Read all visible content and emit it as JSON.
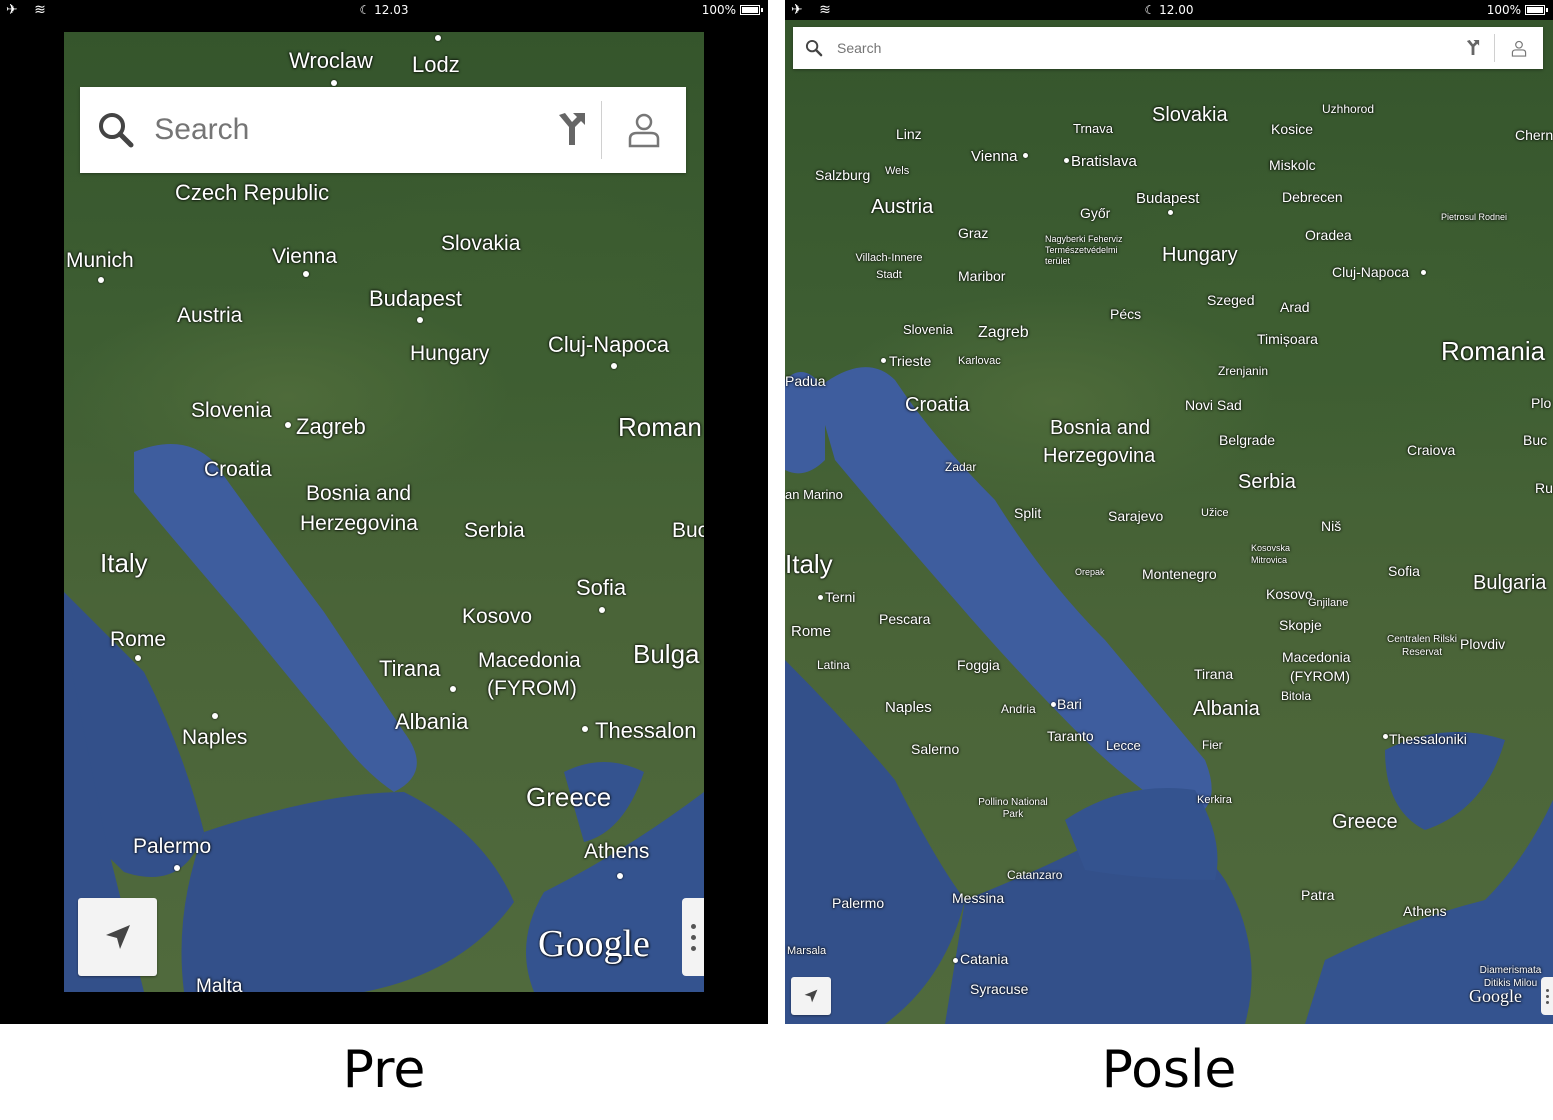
{
  "colors": {
    "sea": "#3d5a9a",
    "land": "#3f5f33",
    "searchbar": "#ffffff",
    "label": "#ffffff"
  },
  "pre": {
    "status": {
      "time": "12.03",
      "battery": "100%",
      "left_icons": "airplane-icon wifi-icon"
    },
    "search": {
      "placeholder": "Search"
    },
    "labels": {
      "wroclaw": "Wroclaw",
      "lodz": "Lodz",
      "czech": "Czech Republic",
      "munich": "Munich",
      "vienna": "Vienna",
      "slovakia": "Slovakia",
      "budapest": "Budapest",
      "austria": "Austria",
      "hungary": "Hungary",
      "cluj": "Cluj-Napoca",
      "slovenia": "Slovenia",
      "zagreb": "Zagreb",
      "romania": "Roman",
      "croatia": "Croatia",
      "bosnia1": "Bosnia and",
      "bosnia2": "Herzegovina",
      "serbia": "Serbia",
      "bucharest": "Buc",
      "italy": "Italy",
      "sofia": "Sofia",
      "kosovo": "Kosovo",
      "rome": "Rome",
      "bulgaria": "Bulga",
      "tirana": "Tirana",
      "macedonia1": "Macedonia",
      "macedonia2": "(FYROM)",
      "albania": "Albania",
      "thessaloniki": "Thessalon",
      "naples": "Naples",
      "greece": "Greece",
      "palermo": "Palermo",
      "athens": "Athens",
      "malta": "Malta"
    },
    "logo": "Google"
  },
  "posle": {
    "status": {
      "time": "12.00",
      "battery": "100%",
      "left_icons": "airplane-icon wifi-icon"
    },
    "search": {
      "placeholder": "Search"
    },
    "labels": {
      "slovakia": "Slovakia",
      "uzhhorod": "Uzhhorod",
      "trnava": "Trnava",
      "kosice": "Kosice",
      "linz": "Linz",
      "vienna": "Vienna",
      "bratislava": "Bratislava",
      "miskolc": "Miskolc",
      "salzburg": "Salzburg",
      "wels": "Wels",
      "chern": "Chern",
      "austria": "Austria",
      "budapest": "Budapest",
      "debrecen": "Debrecen",
      "gyor": "Győr",
      "pietrosul": "Pietrosul Rodnei",
      "graz": "Graz",
      "nagyberki": "Nagyberki Feherviz Természetvédelmi terület",
      "hungary": "Hungary",
      "oradea": "Oradea",
      "villach": "Villach-Innere Stadt",
      "maribor": "Maribor",
      "cluj": "Cluj-Napoca",
      "szeged": "Szeged",
      "arad": "Arad",
      "pecs": "Pécs",
      "slovenia": "Slovenia",
      "zagreb": "Zagreb",
      "timisoara": "Timișoara",
      "trieste": "Trieste",
      "karlovac": "Karlovac",
      "romania": "Romania",
      "zrenjanin": "Zrenjanin",
      "padua": "Padua",
      "novisad": "Novi Sad",
      "croatia": "Croatia",
      "plo": "Plo",
      "bosnia1": "Bosnia and",
      "bosnia2": "Herzegovina",
      "belgrade": "Belgrade",
      "buc": "Buc",
      "craiova": "Craiova",
      "zadar": "Zadar",
      "serbia": "Serbia",
      "ru": "Ru",
      "sanmarino": "an Marino",
      "split": "Split",
      "sarajevo": "Sarajevo",
      "uzice": "Užice",
      "nis": "Niš",
      "kosovska": "Kosovska Mitrovica",
      "italy": "Italy",
      "orepak": "Orepak",
      "montenegro": "Montenegro",
      "sofia": "Sofia",
      "bulgaria": "Bulgaria",
      "terni": "Terni",
      "kosovo": "Kosovo",
      "gnjilane": "Gnjilane",
      "pescara": "Pescara",
      "rome": "Rome",
      "skopje": "Skopje",
      "rilski": "Centralen Rilski Reservat",
      "plovdiv": "Plovdiv",
      "latina": "Latina",
      "foggia": "Foggia",
      "macedonia1": "Macedonia",
      "macedonia2": "(FYROM)",
      "tirana": "Tirana",
      "bitola": "Bitola",
      "albania": "Albania",
      "andria": "Andria",
      "bari": "Bari",
      "naples": "Naples",
      "taranto": "Taranto",
      "lecce": "Lecce",
      "salerno": "Salerno",
      "fier": "Fier",
      "thessaloniki": "Thessaloniki",
      "pollino": "Pollino National Park",
      "kerkira": "Kerkira",
      "greece": "Greece",
      "catanzaro": "Catanzaro",
      "patra": "Patra",
      "palermo": "Palermo",
      "messina": "Messina",
      "athens": "Athens",
      "marsala": "Marsala",
      "catania": "Catania",
      "syracuse": "Syracuse",
      "diamerismata": "Diamerismata Ditikis Milou"
    },
    "logo": "Google"
  },
  "captions": {
    "pre": "Pre",
    "posle": "Posle"
  }
}
